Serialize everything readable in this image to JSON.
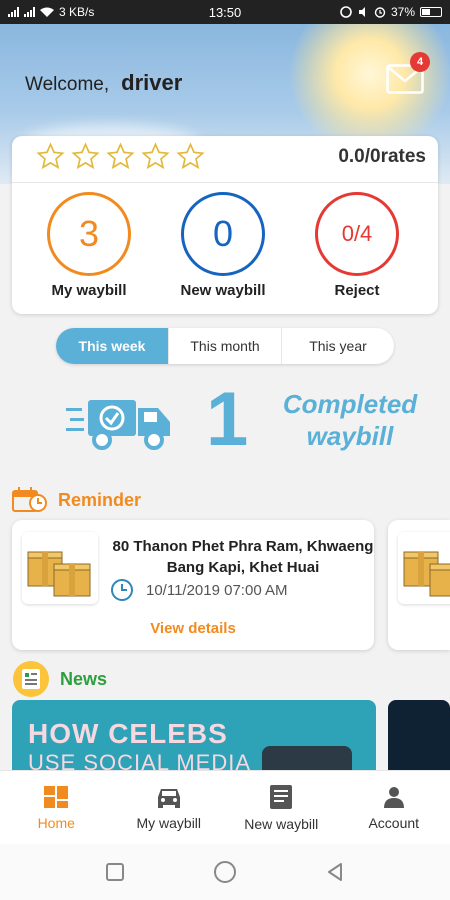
{
  "status_bar": {
    "speed": "3 KB/s",
    "time": "13:50",
    "battery": "37%"
  },
  "header": {
    "welcome": "Welcome,",
    "username": "driver",
    "mail_badge": "4"
  },
  "rating": {
    "text": "0.0/0rates",
    "stars": 0,
    "max_stars": 5
  },
  "stats": [
    {
      "value": "3",
      "label": "My waybill",
      "color": "#f28b1f"
    },
    {
      "value": "0",
      "label": "New waybill",
      "color": "#1565c0"
    },
    {
      "value": "0/4",
      "label": "Reject",
      "color": "#e53935"
    }
  ],
  "period_tabs": [
    {
      "label": "This week",
      "active": true
    },
    {
      "label": "This month",
      "active": false
    },
    {
      "label": "This year",
      "active": false
    }
  ],
  "completed": {
    "count": "1",
    "line1": "Completed",
    "line2": "waybill"
  },
  "reminder": {
    "title": "Reminder",
    "items": [
      {
        "address": "80 Thanon Phet Phra Ram, Khwaeng Bang Kapi, Khet Huai",
        "datetime": "10/11/2019 07:00 AM",
        "action": "View details"
      }
    ]
  },
  "news": {
    "title": "News",
    "banner_line1": "HOW CELEBS",
    "banner_line2": "USE SOCIAL MEDIA"
  },
  "bottom_nav": [
    {
      "label": "Home",
      "icon": "home-icon",
      "active": true
    },
    {
      "label": "My waybill",
      "icon": "car-icon",
      "active": false
    },
    {
      "label": "New waybill",
      "icon": "document-icon",
      "active": false
    },
    {
      "label": "Account",
      "icon": "person-icon",
      "active": false
    }
  ],
  "colors": {
    "accent_blue": "#5ab0d6",
    "orange": "#f28b1f",
    "green": "#2e9e3e",
    "red": "#e53935"
  }
}
